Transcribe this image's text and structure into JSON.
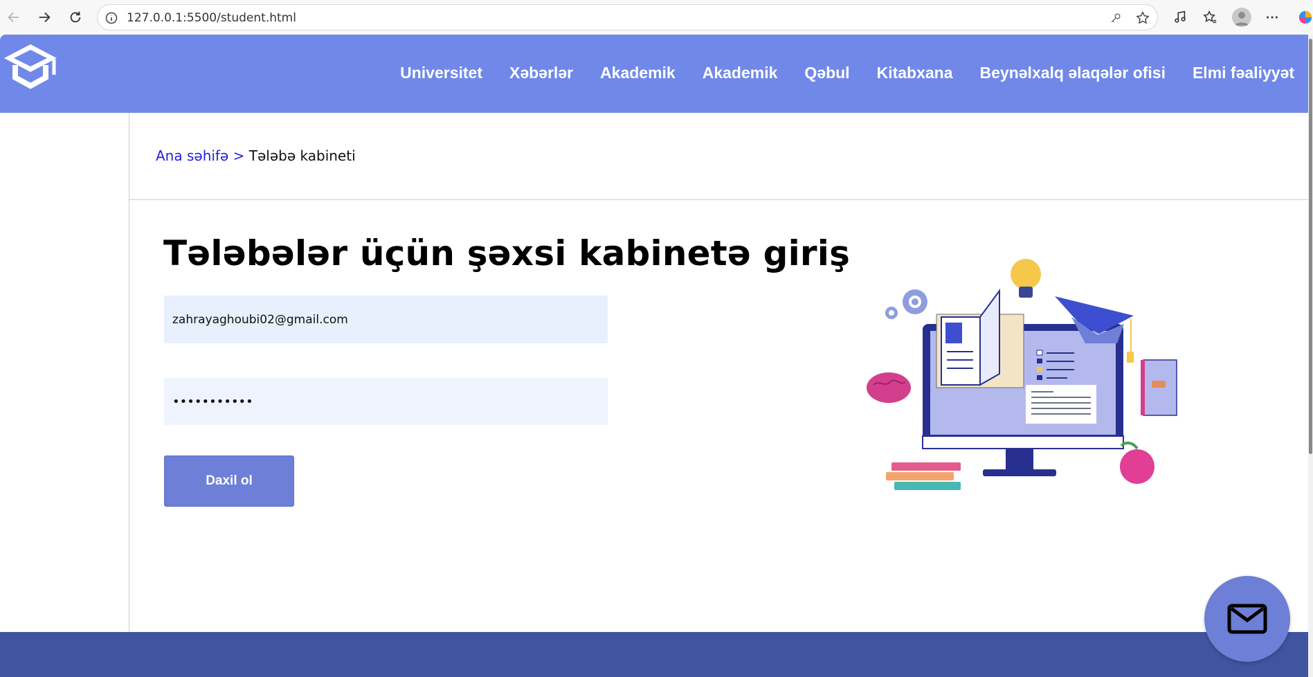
{
  "browser": {
    "url": "127.0.0.1:5500/student.html"
  },
  "header": {
    "nav": [
      "Universitet",
      "Xəbərlər",
      "Akademik",
      "Akademik",
      "Qəbul",
      "Kitabxana",
      "Beynəlxalq əlaqələr ofisi",
      "Elmi fəaliyyət"
    ]
  },
  "breadcrumb": {
    "home": "Ana səhifə",
    "separator": " > ",
    "current": "Tələbə kabineti"
  },
  "login": {
    "title": "Tələbələr üçün şəxsi kabinetə giriş",
    "email_value": "zahrayaghoubi02@gmail.com",
    "password_value": "•••••••••••",
    "submit_label": "Daxil ol"
  },
  "colors": {
    "header_bg": "#7088e8",
    "footer_bg": "#4054a0",
    "button_bg": "#6d7fd6",
    "link": "#1f1fe0"
  },
  "icons": {
    "logo": "graduation-cap-icon",
    "fab": "mail-icon"
  }
}
